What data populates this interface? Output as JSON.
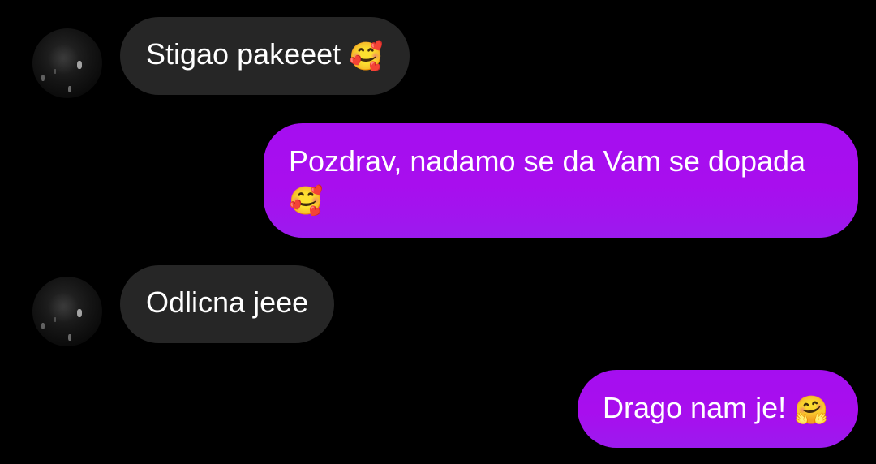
{
  "messages": [
    {
      "direction": "received",
      "text": "Stigao pakeeet",
      "emoji": "🥰",
      "emoji_name": "smiling-face-with-hearts-icon"
    },
    {
      "direction": "sent",
      "text": "Pozdrav, nadamo se da Vam se dopada",
      "emoji": "🥰",
      "emoji_name": "smiling-face-with-hearts-icon"
    },
    {
      "direction": "received",
      "text": "Odlicna jeee",
      "emoji": ""
    },
    {
      "direction": "sent",
      "text": "Drago nam je!",
      "emoji": "🤗",
      "emoji_name": "hugging-face-icon"
    }
  ],
  "colors": {
    "background": "#000000",
    "received_bubble": "#262626",
    "sent_bubble": "#a50ef0",
    "text": "#ffffff"
  }
}
